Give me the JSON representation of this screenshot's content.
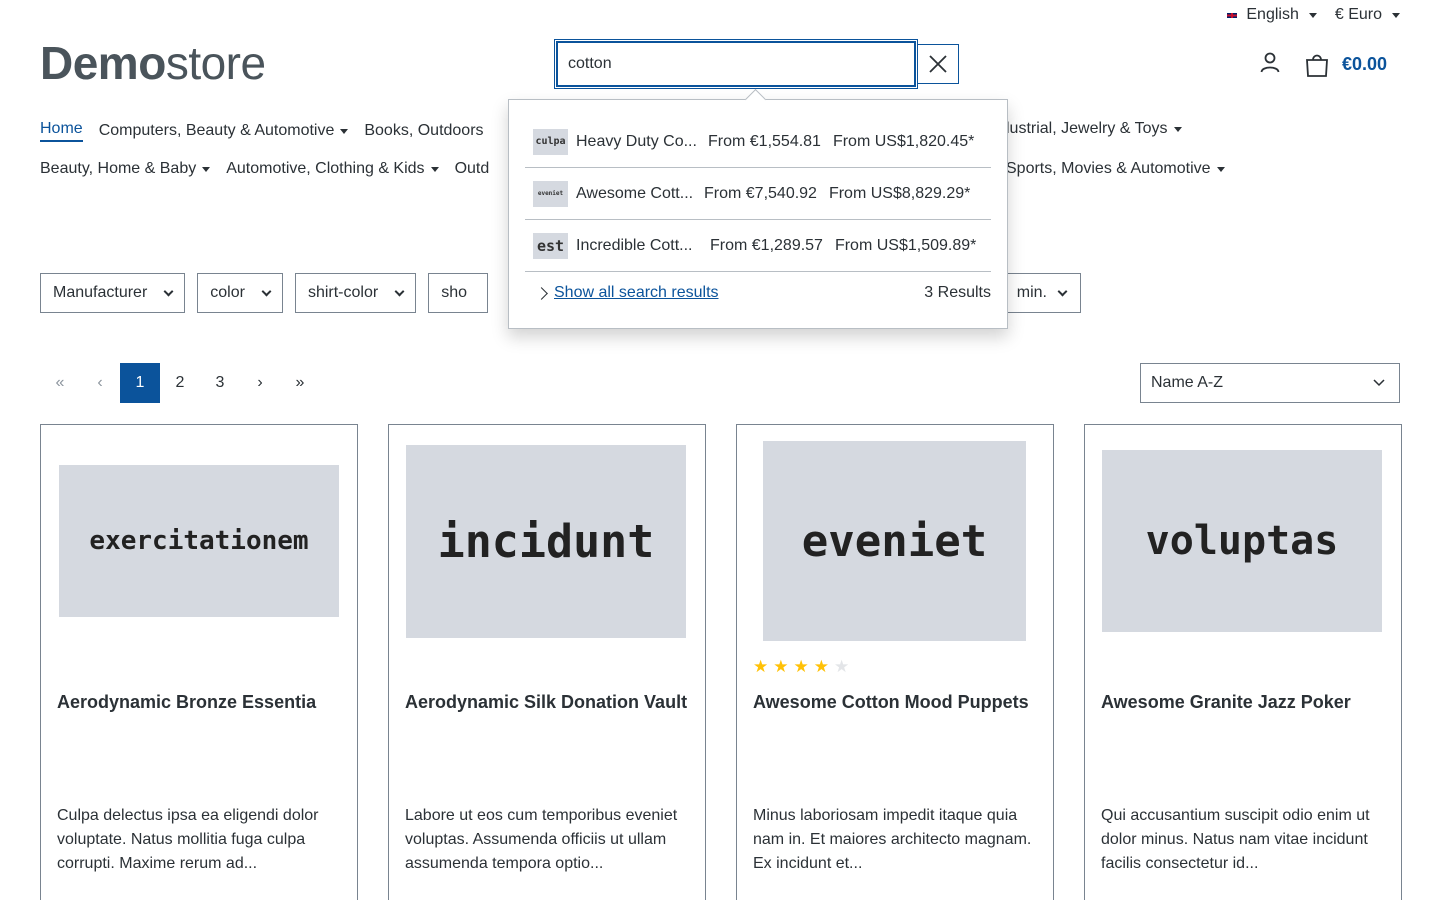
{
  "topbar": {
    "language": "English",
    "currency": "€ Euro"
  },
  "header": {
    "logo_bold": "Demo",
    "logo_light": "store",
    "search_value": "cotton",
    "cart_total": "€0.00"
  },
  "nav": {
    "row1": [
      "Home",
      "Computers, Beauty & Automotive",
      "Books, Outdoors"
    ],
    "row1_right": "lustrial, Jewelry & Toys",
    "row2": [
      "Beauty, Home & Baby",
      "Automotive, Clothing & Kids",
      "Outd"
    ],
    "row2_right": "Sports, Movies & Automotive"
  },
  "filters": [
    "Manufacturer",
    "color",
    "shirt-color",
    "sho"
  ],
  "filter_right": "min.",
  "pagination": {
    "first": "«",
    "prev": "‹",
    "pages": [
      "1",
      "2",
      "3"
    ],
    "next": "›",
    "last": "»",
    "active_page": "1"
  },
  "sort": "Name A-Z",
  "search_dropdown": {
    "suggestions": [
      {
        "thumb": "culpa",
        "name": "Heavy Duty Co...",
        "price": "From €1,554.81",
        "alt_price": "From US$1,820.45*"
      },
      {
        "thumb": "eveniet",
        "name": "Awesome Cott...",
        "price": "From €7,540.92",
        "alt_price": "From US$8,829.29*"
      },
      {
        "thumb": "est",
        "name": "Incredible Cott...",
        "price": "From €1,289.57",
        "alt_price": "From US$1,509.89*"
      }
    ],
    "show_all": "Show all search results",
    "results_count": "3 Results"
  },
  "products": [
    {
      "image_text": "exercitationem",
      "title": "Aerodynamic Bronze Essentia",
      "description": "Culpa delectus ipsa ea eligendi dolor voluptate. Natus mollitia fuga culpa corrupti. Maxime rerum ad...",
      "rating": 0
    },
    {
      "image_text": "incidunt",
      "title": "Aerodynamic Silk Donation Vault",
      "description": "Labore ut eos cum temporibus eveniet voluptas. Assumenda officiis ut ullam assumenda tempora optio...",
      "rating": 0
    },
    {
      "image_text": "eveniet",
      "title": "Awesome Cotton Mood Puppets",
      "description": "Minus laboriosam impedit itaque quia nam in. Et maiores architecto magnam. Ex incidunt et...",
      "rating": 4
    },
    {
      "image_text": "voluptas",
      "title": "Awesome Granite Jazz Poker",
      "description": "Qui accusantium suscipit odio enim ut dolor minus. Natus nam vitae incidunt facilis consectetur id...",
      "rating": 0
    }
  ],
  "colors": {
    "primary": "#0b539b",
    "text": "#2b3136",
    "placeholder_bg": "#d5d9e0",
    "star": "#ffc107"
  }
}
